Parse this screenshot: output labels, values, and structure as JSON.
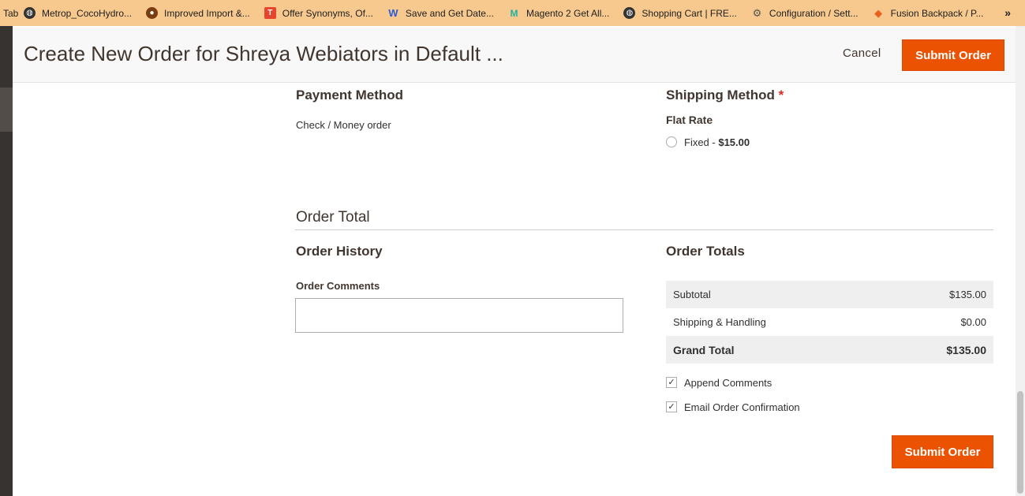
{
  "bookmarks": {
    "tab_label": "Tab",
    "items": [
      {
        "label": "Metrop_CocoHydro...",
        "icon": "globe-icon"
      },
      {
        "label": "Improved Import &...",
        "icon": "site-favicon-icon"
      },
      {
        "label": "Offer Synonyms, Of...",
        "icon": "t-logo-icon"
      },
      {
        "label": "Save and Get Date...",
        "icon": "w-logo-icon"
      },
      {
        "label": "Magento 2 Get All...",
        "icon": "m-logo-icon"
      },
      {
        "label": "Shopping Cart | FRE...",
        "icon": "globe-icon"
      },
      {
        "label": "Configuration / Sett...",
        "icon": "gear-logo-icon"
      },
      {
        "label": "Fusion Backpack / P...",
        "icon": "magento-logo-icon"
      }
    ],
    "more": "»"
  },
  "header": {
    "title": "Create New Order for Shreya Webiators in Default ...",
    "cancel_label": "Cancel",
    "submit_label": "Submit Order"
  },
  "payment": {
    "title": "Payment Method",
    "method": "Check / Money order"
  },
  "shipping": {
    "title": "Shipping Method",
    "required_mark": "*",
    "carrier": "Flat Rate",
    "option_label": "Fixed - ",
    "option_price": "$15.00"
  },
  "order_total": {
    "title": "Order Total"
  },
  "history": {
    "title": "Order History",
    "comments_label": "Order Comments",
    "comments_value": ""
  },
  "totals": {
    "title": "Order Totals",
    "subtotal_label": "Subtotal",
    "subtotal_value": "$135.00",
    "shipping_label": "Shipping & Handling",
    "shipping_value": "$0.00",
    "grand_label": "Grand Total",
    "grand_value": "$135.00"
  },
  "options": {
    "append_comments": "Append Comments",
    "email_confirmation": "Email Order Confirmation",
    "check_glyph": "✓"
  },
  "footer": {
    "submit_label": "Submit Order"
  },
  "colors": {
    "accent": "#eb5202",
    "bookmarks_bg": "#f7c98e",
    "sidebar": "#373330"
  }
}
